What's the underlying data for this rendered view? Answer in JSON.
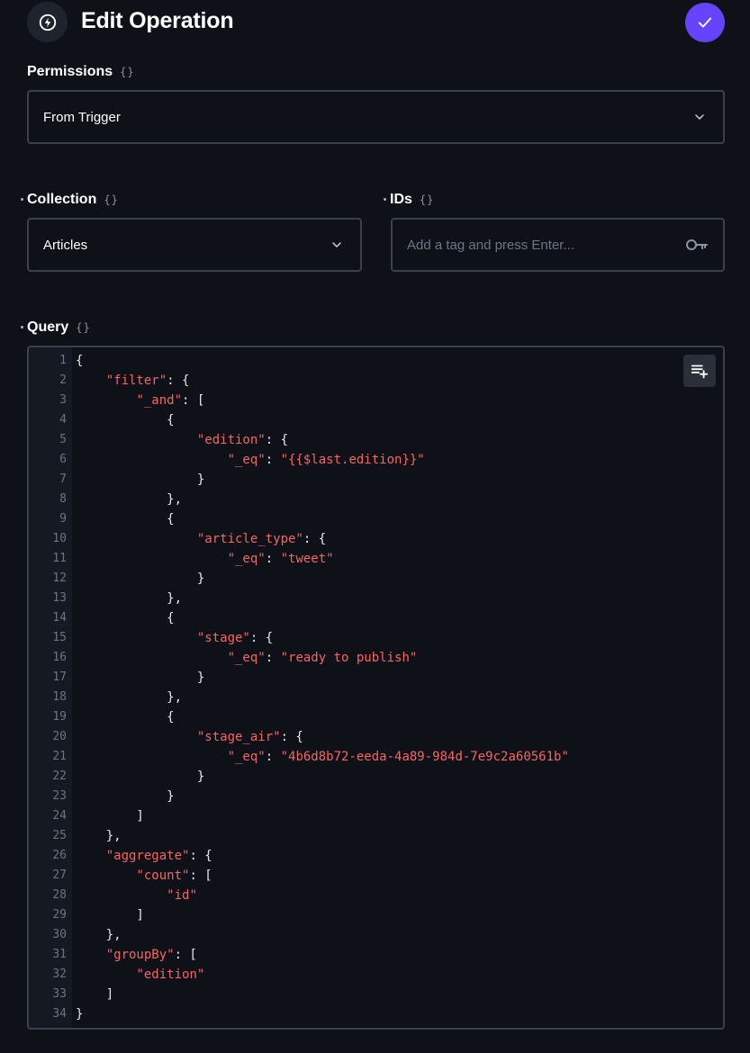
{
  "header": {
    "title": "Edit Operation",
    "icon": "bolt-icon",
    "confirm_icon": "check-icon",
    "accent": "#6644ff"
  },
  "raw_toggle_label": "{}",
  "permissions": {
    "label": "Permissions",
    "value": "From Trigger"
  },
  "collection": {
    "label": "Collection",
    "value": "Articles"
  },
  "ids": {
    "label": "IDs",
    "placeholder": "Add a tag and press Enter..."
  },
  "query": {
    "label": "Query",
    "lines": [
      [
        {
          "t": "p",
          "v": "{"
        }
      ],
      [
        {
          "t": "p",
          "v": "    "
        },
        {
          "t": "s",
          "v": "\"filter\""
        },
        {
          "t": "p",
          "v": ": {"
        }
      ],
      [
        {
          "t": "p",
          "v": "        "
        },
        {
          "t": "s",
          "v": "\"_and\""
        },
        {
          "t": "p",
          "v": ": ["
        }
      ],
      [
        {
          "t": "p",
          "v": "            {"
        }
      ],
      [
        {
          "t": "p",
          "v": "                "
        },
        {
          "t": "s",
          "v": "\"edition\""
        },
        {
          "t": "p",
          "v": ": {"
        }
      ],
      [
        {
          "t": "p",
          "v": "                    "
        },
        {
          "t": "s",
          "v": "\"_eq\""
        },
        {
          "t": "p",
          "v": ": "
        },
        {
          "t": "s",
          "v": "\"{{$last.edition}}\""
        }
      ],
      [
        {
          "t": "p",
          "v": "                }"
        }
      ],
      [
        {
          "t": "p",
          "v": "            },"
        }
      ],
      [
        {
          "t": "p",
          "v": "            {"
        }
      ],
      [
        {
          "t": "p",
          "v": "                "
        },
        {
          "t": "s",
          "v": "\"article_type\""
        },
        {
          "t": "p",
          "v": ": {"
        }
      ],
      [
        {
          "t": "p",
          "v": "                    "
        },
        {
          "t": "s",
          "v": "\"_eq\""
        },
        {
          "t": "p",
          "v": ": "
        },
        {
          "t": "s",
          "v": "\"tweet\""
        }
      ],
      [
        {
          "t": "p",
          "v": "                }"
        }
      ],
      [
        {
          "t": "p",
          "v": "            },"
        }
      ],
      [
        {
          "t": "p",
          "v": "            {"
        }
      ],
      [
        {
          "t": "p",
          "v": "                "
        },
        {
          "t": "s",
          "v": "\"stage\""
        },
        {
          "t": "p",
          "v": ": {"
        }
      ],
      [
        {
          "t": "p",
          "v": "                    "
        },
        {
          "t": "s",
          "v": "\"_eq\""
        },
        {
          "t": "p",
          "v": ": "
        },
        {
          "t": "s",
          "v": "\"ready to publish\""
        }
      ],
      [
        {
          "t": "p",
          "v": "                }"
        }
      ],
      [
        {
          "t": "p",
          "v": "            },"
        }
      ],
      [
        {
          "t": "p",
          "v": "            {"
        }
      ],
      [
        {
          "t": "p",
          "v": "                "
        },
        {
          "t": "s",
          "v": "\"stage_air\""
        },
        {
          "t": "p",
          "v": ": {"
        }
      ],
      [
        {
          "t": "p",
          "v": "                    "
        },
        {
          "t": "s",
          "v": "\"_eq\""
        },
        {
          "t": "p",
          "v": ": "
        },
        {
          "t": "s",
          "v": "\"4b6d8b72-eeda-4a89-984d-7e9c2a60561b\""
        }
      ],
      [
        {
          "t": "p",
          "v": "                }"
        }
      ],
      [
        {
          "t": "p",
          "v": "            }"
        }
      ],
      [
        {
          "t": "p",
          "v": "        ]"
        }
      ],
      [
        {
          "t": "p",
          "v": "    },"
        }
      ],
      [
        {
          "t": "p",
          "v": "    "
        },
        {
          "t": "s",
          "v": "\"aggregate\""
        },
        {
          "t": "p",
          "v": ": {"
        }
      ],
      [
        {
          "t": "p",
          "v": "        "
        },
        {
          "t": "s",
          "v": "\"count\""
        },
        {
          "t": "p",
          "v": ": ["
        }
      ],
      [
        {
          "t": "p",
          "v": "            "
        },
        {
          "t": "s",
          "v": "\"id\""
        }
      ],
      [
        {
          "t": "p",
          "v": "        ]"
        }
      ],
      [
        {
          "t": "p",
          "v": "    },"
        }
      ],
      [
        {
          "t": "p",
          "v": "    "
        },
        {
          "t": "s",
          "v": "\"groupBy\""
        },
        {
          "t": "p",
          "v": ": ["
        }
      ],
      [
        {
          "t": "p",
          "v": "        "
        },
        {
          "t": "s",
          "v": "\"edition\""
        }
      ],
      [
        {
          "t": "p",
          "v": "    ]"
        }
      ],
      [
        {
          "t": "p",
          "v": "}"
        }
      ]
    ],
    "format_icon": "playlist-add-icon"
  },
  "colors": {
    "background": "#0e1118",
    "border": "#3a404d",
    "string_token": "#f86464",
    "punctuation_token": "#e6e9ef",
    "line_number": "#6b7385"
  }
}
